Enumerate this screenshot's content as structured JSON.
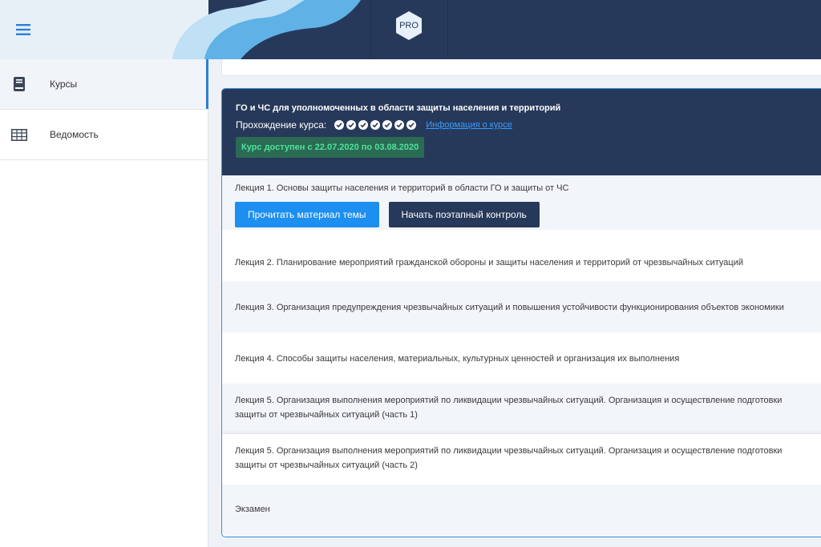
{
  "header": {
    "logo_text": "PRO",
    "colors": {
      "bar": "#27395a",
      "wave_light": "#bfe0f5",
      "wave_mid": "#5fb1e6",
      "panel": "#e7f0f7"
    }
  },
  "sidebar": {
    "items": [
      {
        "label": "Курсы",
        "icon": "book-icon",
        "active": true
      },
      {
        "label": "Ведомость",
        "icon": "table-icon",
        "active": false
      }
    ]
  },
  "course": {
    "title": "ГО и ЧС для уполномоченных в области защиты населения и территорий",
    "progress_label": "Прохождение курса:",
    "progress_checks": 7,
    "info_link": "Информация о курсе",
    "availability": "Курс доступен с 22.07.2020 по 03.08.2020",
    "lectures": [
      {
        "title": "Лекция 1. Основы защиты населения и территорий в области ГО и защиты от ЧС"
      },
      {
        "title": "Лекция 2. Планирование мероприятий гражданской обороны и защиты населения и территорий от чрезвычайных ситуаций"
      },
      {
        "title": "Лекция 3. Организация предупреждения чрезвычайных ситуаций и повышения устойчивости функционирования объектов экономики"
      },
      {
        "title": "Лекция 4. Способы защиты населения, материальных, культурных ценностей и организация их выполнения"
      },
      {
        "title": "Лекция 5. Организация выполнения мероприятий по ликвидации чрезвычайных ситуаций. Организация и осуществление подготовки",
        "title2": "защиты от чрезвычайных ситуаций (часть 1)"
      },
      {
        "title": "Лекция 5. Организация выполнения мероприятий по ликвидации чрезвычайных ситуаций. Организация и осуществление подготовки",
        "title2": "защиты от чрезвычайных ситуаций (часть 2)"
      },
      {
        "title": "Экзамен"
      }
    ],
    "buttons": {
      "read_label": "Прочитать материал темы",
      "control_label": "Начать поэтапный контроль"
    }
  }
}
